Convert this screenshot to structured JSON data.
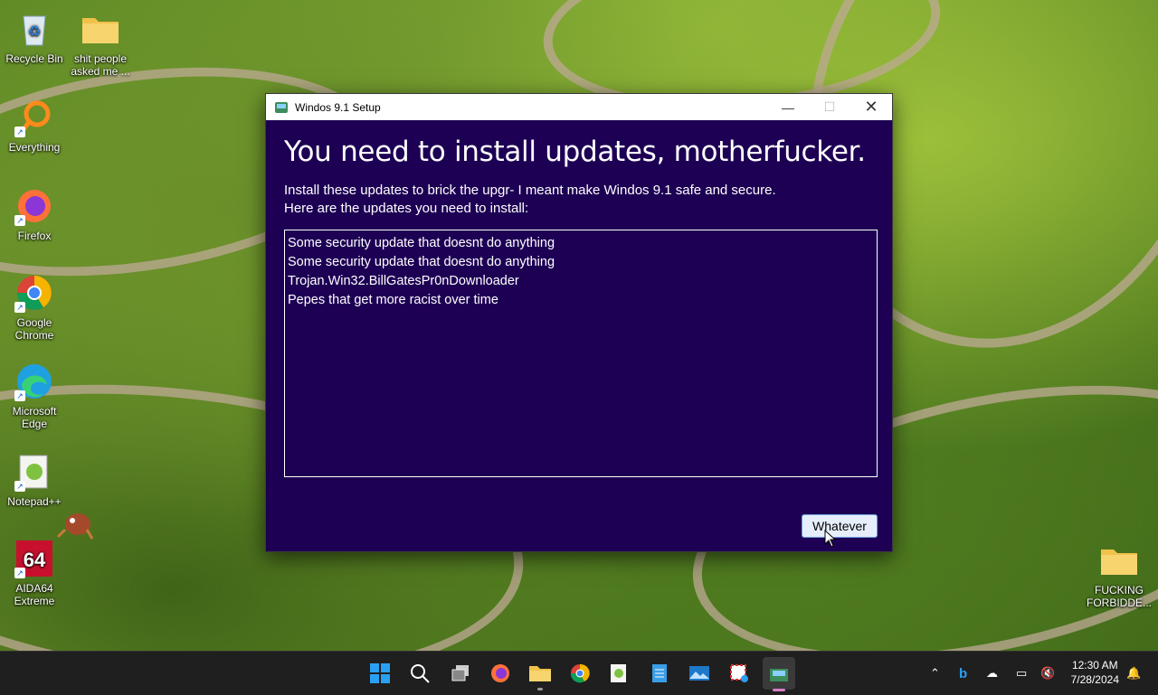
{
  "desktop": {
    "icons": [
      {
        "label": "Recycle Bin"
      },
      {
        "label": "shit people asked me ..."
      },
      {
        "label": "Everything"
      },
      {
        "label": "Firefox"
      },
      {
        "label": "Google Chrome"
      },
      {
        "label": "Microsoft Edge"
      },
      {
        "label": "Notepad++"
      },
      {
        "label": "AIDA64 Extreme"
      },
      {
        "label": "FUCKING FORBIDDE..."
      }
    ]
  },
  "dialog": {
    "title": "Windos 9.1 Setup",
    "headline": "You need to install updates, motherfucker.",
    "description_line1": "Install these updates to brick the upgr- I meant make Windos 9.1 safe and secure.",
    "description_line2": "Here are the updates you need to install:",
    "updates": [
      "Some security update that doesnt do anything",
      "Some security update that doesnt do anything",
      "Trojan.Win32.BillGatesPr0nDownloader",
      "Pepes that get more racist over time"
    ],
    "button_label": "Whatever"
  },
  "taskbar": {
    "apps": [
      "start-icon",
      "search-icon",
      "task-view-icon",
      "firefox-icon",
      "file-explorer-icon",
      "chrome-icon",
      "notepadpp-icon",
      "notepad-icon",
      "photos-icon",
      "snipping-tool-icon",
      "setup-icon"
    ],
    "clock": {
      "time": "12:30 AM",
      "date": "7/28/2024"
    }
  },
  "colors": {
    "dialog_bg": "#1d0054",
    "taskbar_bg": "#1f1f1f",
    "accent": "#0078d4"
  }
}
